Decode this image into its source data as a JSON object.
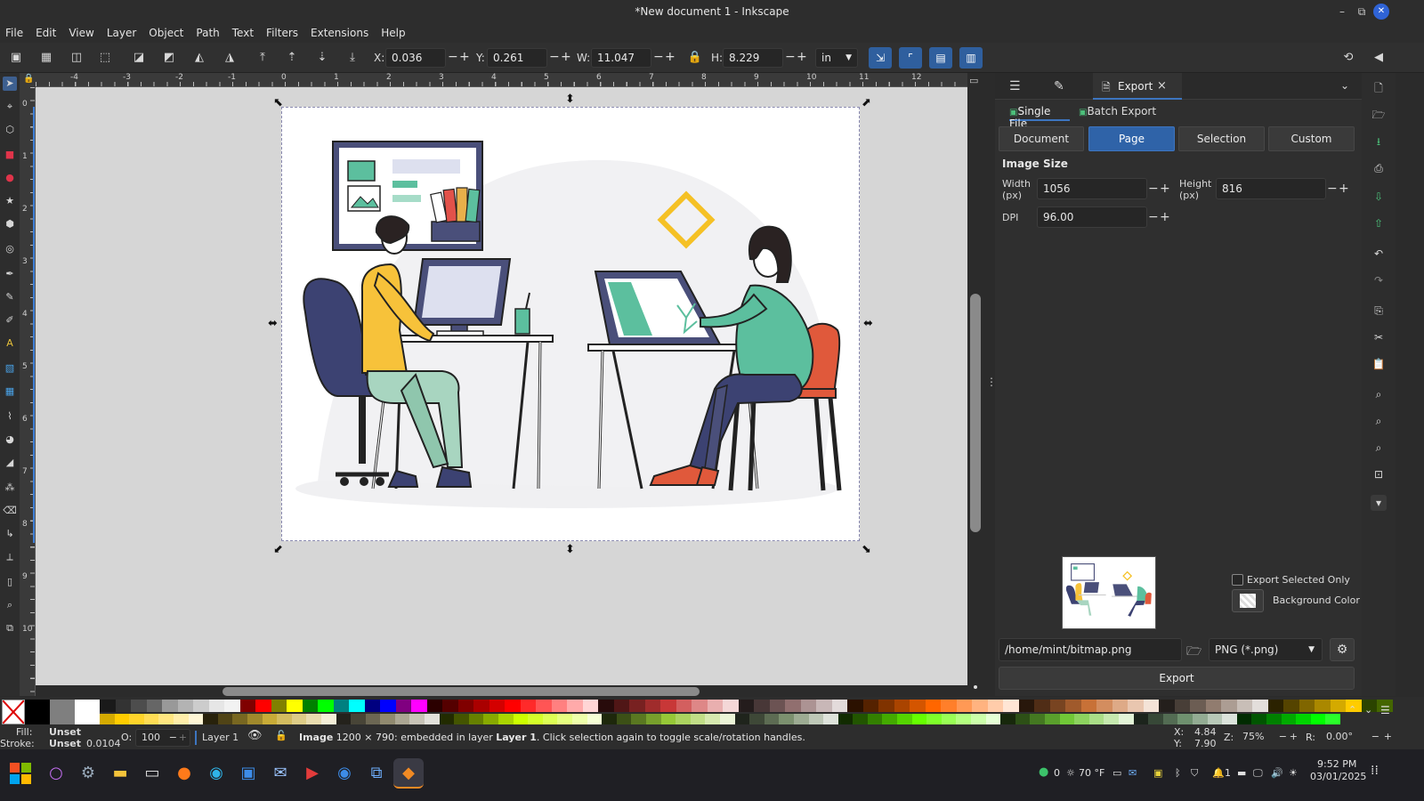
{
  "window": {
    "title": "*New document 1 - Inkscape",
    "minimize": "–",
    "maximize": "⧉",
    "close": "✕"
  },
  "menu": [
    "File",
    "Edit",
    "View",
    "Layer",
    "Object",
    "Path",
    "Text",
    "Filters",
    "Extensions",
    "Help"
  ],
  "toolbar": {
    "x_label": "X:",
    "x_value": "0.036",
    "y_label": "Y:",
    "y_value": "0.261",
    "w_label": "W:",
    "w_value": "11.047",
    "h_label": "H:",
    "h_value": "8.229",
    "unit": "in",
    "minus": "−",
    "plus": "+"
  },
  "ruler": {
    "top_ticks": [
      "-4",
      "-3",
      "-2",
      "-1",
      "0",
      "1",
      "2",
      "3",
      "4",
      "5",
      "6",
      "7",
      "8",
      "9",
      "10",
      "11",
      "12"
    ],
    "left_ticks": [
      "0",
      "1",
      "2",
      "3",
      "4",
      "5",
      "6",
      "7",
      "8",
      "9",
      "10"
    ]
  },
  "panel": {
    "tab_label": "Export",
    "tab_close": "×",
    "mode_single": "Single File",
    "mode_batch": "Batch Export",
    "areas": [
      "Document",
      "Page",
      "Selection",
      "Custom"
    ],
    "active_area": "Page",
    "image_size_title": "Image Size",
    "width_label": "Width\n(px)",
    "width_value": "1056",
    "height_label": "Height\n(px)",
    "height_value": "816",
    "dpi_label": "DPI",
    "dpi_value": "96.00",
    "export_selected_only": "Export Selected Only",
    "background_color": "Background Color",
    "filename": "/home/mint/bitmap.png",
    "format": "PNG (*.png)",
    "export_button": "Export"
  },
  "status": {
    "fill_label": "Fill:",
    "fill_value": "Unset",
    "stroke_label": "Stroke:",
    "stroke_value": "Unset",
    "stroke_width": "0.0104",
    "opacity_label": "O:",
    "opacity_value": "100",
    "layer": "Layer 1",
    "message_bold": "Image",
    "message": " 1200 × 790: embedded in layer ",
    "message_layer": "Layer 1",
    "message_tail": ". Click selection again to toggle scale/rotation handles.",
    "cursor_x_label": "X:",
    "cursor_x": "4.84",
    "cursor_y_label": "Y:",
    "cursor_y": "7.90",
    "zoom_label": "Z:",
    "zoom": "75%",
    "rotate_label": "R:",
    "rotate": "0.00°"
  },
  "taskbar": {
    "notifications": "0",
    "weather": "70 °F",
    "bell_count": "1",
    "time": "9:52 PM",
    "date": "03/01/2025"
  },
  "palette_colors_top": [
    "#000000",
    "#7f7f7f",
    "#ffffff",
    "#1a1a1a",
    "#333333",
    "#4d4d4d",
    "#666666",
    "#999999",
    "#b3b3b3",
    "#cccccc",
    "#e6e6e6",
    "#f2f2f2",
    "#800000",
    "#ff0000",
    "#808000",
    "#ffff00",
    "#008000",
    "#00ff00",
    "#008080",
    "#00ffff",
    "#000080",
    "#0000ff",
    "#800080",
    "#ff00ff",
    "#2b0000",
    "#550000",
    "#800000",
    "#aa0000",
    "#d40000",
    "#ff0000",
    "#ff2a2a",
    "#ff5555",
    "#ff8080",
    "#ffaaaa",
    "#ffd5d5",
    "#280b0b",
    "#501616",
    "#782121",
    "#a02c2c",
    "#c83737",
    "#d35f5f",
    "#de8787",
    "#e9afaf",
    "#f4d7d7",
    "#241c1c",
    "#483737",
    "#6c5353",
    "#916f6f",
    "#ac9393",
    "#c8b7b7",
    "#e3dbdb",
    "#2b1100",
    "#552200",
    "#803300",
    "#aa4400",
    "#d45500",
    "#ff6600",
    "#ff7f2a",
    "#ff9955",
    "#ffb380",
    "#ffccaa",
    "#ffe6d5",
    "#28170b",
    "#502d16",
    "#784421",
    "#a05a2c",
    "#c87137",
    "#d38d5f",
    "#deaa87",
    "#e9c6af",
    "#f4e3d7",
    "#241f1c",
    "#483e37",
    "#6c5d53",
    "#917c6f",
    "#ac9d93",
    "#c8beb7",
    "#e3dedb",
    "#2b2200",
    "#554400",
    "#806600",
    "#aa8800",
    "#d4aa00",
    "#ffcc00",
    "#2b4400",
    "#446600"
  ],
  "palette_colors_bottom": [
    "#d4aa00",
    "#ffcc00",
    "#ffd42a",
    "#ffdd55",
    "#ffe680",
    "#ffeeaa",
    "#fff6d5",
    "#28220b",
    "#504416",
    "#786721",
    "#a0892c",
    "#c8ab37",
    "#d3bc5f",
    "#decd87",
    "#e9ddaf",
    "#f4eed7",
    "#24221c",
    "#484537",
    "#6c6753",
    "#918a6f",
    "#aca793",
    "#c8c4b7",
    "#e3e2db",
    "#222b00",
    "#445500",
    "#668000",
    "#88aa00",
    "#aad400",
    "#ccff00",
    "#d4ff2a",
    "#ddff55",
    "#e5ff80",
    "#eeffaa",
    "#f6ffd5",
    "#1e280b",
    "#3c5016",
    "#5a7821",
    "#78a02c",
    "#96c837",
    "#abd35f",
    "#c1de87",
    "#d6e9af",
    "#ebf4d7",
    "#1f241c",
    "#3e4837",
    "#5d6c53",
    "#7c916f",
    "#9dac93",
    "#bec8b7",
    "#dee3db",
    "#112b00",
    "#225500",
    "#338000",
    "#44aa00",
    "#55d400",
    "#66ff00",
    "#7fff2a",
    "#99ff55",
    "#b3ff80",
    "#ccffaa",
    "#e5ffd5",
    "#17280b",
    "#2d5016",
    "#447821",
    "#5aa02c",
    "#71c837",
    "#8dd35f",
    "#aade87",
    "#c6e9af",
    "#e3f4d7",
    "#1c241c",
    "#374837",
    "#536c53",
    "#6f916f",
    "#93ac93",
    "#b7c8b7",
    "#dbe3db",
    "#002b00",
    "#005500",
    "#008000",
    "#00aa00",
    "#00d400",
    "#00ff00",
    "#2aff2a"
  ]
}
